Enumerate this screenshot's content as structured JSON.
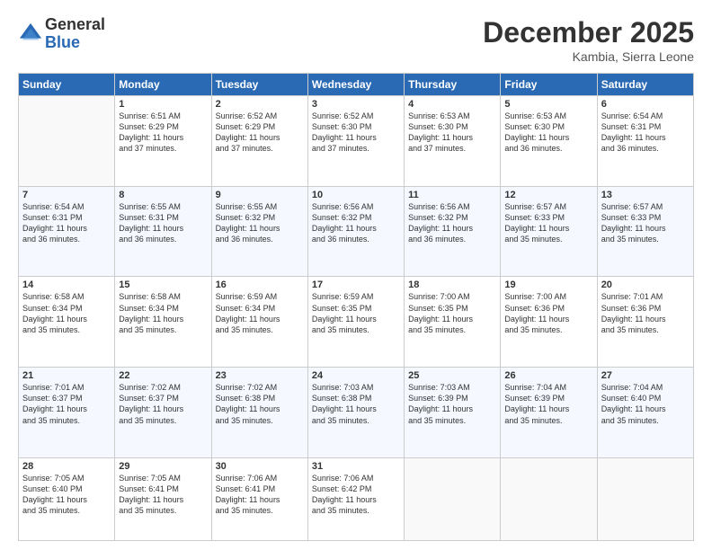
{
  "logo": {
    "general": "General",
    "blue": "Blue"
  },
  "title": "December 2025",
  "subtitle": "Kambia, Sierra Leone",
  "days_header": [
    "Sunday",
    "Monday",
    "Tuesday",
    "Wednesday",
    "Thursday",
    "Friday",
    "Saturday"
  ],
  "weeks": [
    [
      {
        "num": "",
        "empty": true
      },
      {
        "num": "1",
        "sunrise": "Sunrise: 6:51 AM",
        "sunset": "Sunset: 6:29 PM",
        "daylight": "Daylight: 11 hours and 37 minutes."
      },
      {
        "num": "2",
        "sunrise": "Sunrise: 6:52 AM",
        "sunset": "Sunset: 6:29 PM",
        "daylight": "Daylight: 11 hours and 37 minutes."
      },
      {
        "num": "3",
        "sunrise": "Sunrise: 6:52 AM",
        "sunset": "Sunset: 6:30 PM",
        "daylight": "Daylight: 11 hours and 37 minutes."
      },
      {
        "num": "4",
        "sunrise": "Sunrise: 6:53 AM",
        "sunset": "Sunset: 6:30 PM",
        "daylight": "Daylight: 11 hours and 37 minutes."
      },
      {
        "num": "5",
        "sunrise": "Sunrise: 6:53 AM",
        "sunset": "Sunset: 6:30 PM",
        "daylight": "Daylight: 11 hours and 36 minutes."
      },
      {
        "num": "6",
        "sunrise": "Sunrise: 6:54 AM",
        "sunset": "Sunset: 6:31 PM",
        "daylight": "Daylight: 11 hours and 36 minutes."
      }
    ],
    [
      {
        "num": "7",
        "sunrise": "Sunrise: 6:54 AM",
        "sunset": "Sunset: 6:31 PM",
        "daylight": "Daylight: 11 hours and 36 minutes."
      },
      {
        "num": "8",
        "sunrise": "Sunrise: 6:55 AM",
        "sunset": "Sunset: 6:31 PM",
        "daylight": "Daylight: 11 hours and 36 minutes."
      },
      {
        "num": "9",
        "sunrise": "Sunrise: 6:55 AM",
        "sunset": "Sunset: 6:32 PM",
        "daylight": "Daylight: 11 hours and 36 minutes."
      },
      {
        "num": "10",
        "sunrise": "Sunrise: 6:56 AM",
        "sunset": "Sunset: 6:32 PM",
        "daylight": "Daylight: 11 hours and 36 minutes."
      },
      {
        "num": "11",
        "sunrise": "Sunrise: 6:56 AM",
        "sunset": "Sunset: 6:32 PM",
        "daylight": "Daylight: 11 hours and 36 minutes."
      },
      {
        "num": "12",
        "sunrise": "Sunrise: 6:57 AM",
        "sunset": "Sunset: 6:33 PM",
        "daylight": "Daylight: 11 hours and 35 minutes."
      },
      {
        "num": "13",
        "sunrise": "Sunrise: 6:57 AM",
        "sunset": "Sunset: 6:33 PM",
        "daylight": "Daylight: 11 hours and 35 minutes."
      }
    ],
    [
      {
        "num": "14",
        "sunrise": "Sunrise: 6:58 AM",
        "sunset": "Sunset: 6:34 PM",
        "daylight": "Daylight: 11 hours and 35 minutes."
      },
      {
        "num": "15",
        "sunrise": "Sunrise: 6:58 AM",
        "sunset": "Sunset: 6:34 PM",
        "daylight": "Daylight: 11 hours and 35 minutes."
      },
      {
        "num": "16",
        "sunrise": "Sunrise: 6:59 AM",
        "sunset": "Sunset: 6:34 PM",
        "daylight": "Daylight: 11 hours and 35 minutes."
      },
      {
        "num": "17",
        "sunrise": "Sunrise: 6:59 AM",
        "sunset": "Sunset: 6:35 PM",
        "daylight": "Daylight: 11 hours and 35 minutes."
      },
      {
        "num": "18",
        "sunrise": "Sunrise: 7:00 AM",
        "sunset": "Sunset: 6:35 PM",
        "daylight": "Daylight: 11 hours and 35 minutes."
      },
      {
        "num": "19",
        "sunrise": "Sunrise: 7:00 AM",
        "sunset": "Sunset: 6:36 PM",
        "daylight": "Daylight: 11 hours and 35 minutes."
      },
      {
        "num": "20",
        "sunrise": "Sunrise: 7:01 AM",
        "sunset": "Sunset: 6:36 PM",
        "daylight": "Daylight: 11 hours and 35 minutes."
      }
    ],
    [
      {
        "num": "21",
        "sunrise": "Sunrise: 7:01 AM",
        "sunset": "Sunset: 6:37 PM",
        "daylight": "Daylight: 11 hours and 35 minutes."
      },
      {
        "num": "22",
        "sunrise": "Sunrise: 7:02 AM",
        "sunset": "Sunset: 6:37 PM",
        "daylight": "Daylight: 11 hours and 35 minutes."
      },
      {
        "num": "23",
        "sunrise": "Sunrise: 7:02 AM",
        "sunset": "Sunset: 6:38 PM",
        "daylight": "Daylight: 11 hours and 35 minutes."
      },
      {
        "num": "24",
        "sunrise": "Sunrise: 7:03 AM",
        "sunset": "Sunset: 6:38 PM",
        "daylight": "Daylight: 11 hours and 35 minutes."
      },
      {
        "num": "25",
        "sunrise": "Sunrise: 7:03 AM",
        "sunset": "Sunset: 6:39 PM",
        "daylight": "Daylight: 11 hours and 35 minutes."
      },
      {
        "num": "26",
        "sunrise": "Sunrise: 7:04 AM",
        "sunset": "Sunset: 6:39 PM",
        "daylight": "Daylight: 11 hours and 35 minutes."
      },
      {
        "num": "27",
        "sunrise": "Sunrise: 7:04 AM",
        "sunset": "Sunset: 6:40 PM",
        "daylight": "Daylight: 11 hours and 35 minutes."
      }
    ],
    [
      {
        "num": "28",
        "sunrise": "Sunrise: 7:05 AM",
        "sunset": "Sunset: 6:40 PM",
        "daylight": "Daylight: 11 hours and 35 minutes."
      },
      {
        "num": "29",
        "sunrise": "Sunrise: 7:05 AM",
        "sunset": "Sunset: 6:41 PM",
        "daylight": "Daylight: 11 hours and 35 minutes."
      },
      {
        "num": "30",
        "sunrise": "Sunrise: 7:06 AM",
        "sunset": "Sunset: 6:41 PM",
        "daylight": "Daylight: 11 hours and 35 minutes."
      },
      {
        "num": "31",
        "sunrise": "Sunrise: 7:06 AM",
        "sunset": "Sunset: 6:42 PM",
        "daylight": "Daylight: 11 hours and 35 minutes."
      },
      {
        "num": "",
        "empty": true
      },
      {
        "num": "",
        "empty": true
      },
      {
        "num": "",
        "empty": true
      }
    ]
  ]
}
